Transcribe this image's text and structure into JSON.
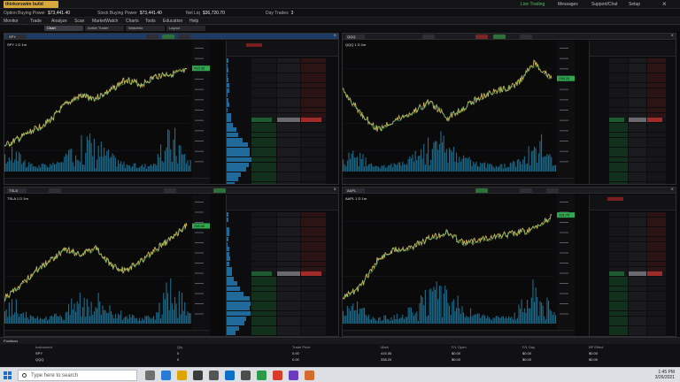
{
  "app": {
    "badge": "thinkorswim build",
    "top_links": [
      "Messages",
      "Support/Chat",
      "Setup"
    ],
    "status": "Live Trading"
  },
  "account_bar": [
    {
      "label": "Option Buying Power",
      "value": "$73,441.40"
    },
    {
      "label": "Stock Buying Power",
      "value": "$73,441.40"
    },
    {
      "label": "Net Liq",
      "value": "$36,720.70"
    },
    {
      "label": "Day Trades",
      "value": "3"
    }
  ],
  "menu": [
    "Monitor",
    "Trade",
    "Analyze",
    "Scan",
    "MarketWatch",
    "Charts",
    "Tools",
    "Education",
    "Help"
  ],
  "tabs": [
    "Chart",
    "Active Trader",
    "Watchlist",
    "Layout"
  ],
  "panels": [
    {
      "id": "tl",
      "symbol": "SPY",
      "title": "SPY 1 D 1m",
      "price_tag": "415.35",
      "active": true
    },
    {
      "id": "tr",
      "symbol": "QQQ",
      "title": "QQQ 1 D 1m",
      "price_tag": "338.20",
      "active": false
    },
    {
      "id": "bl",
      "symbol": "TSLA",
      "title": "TSLA 1 D 1m",
      "price_tag": "706.90",
      "active": false
    },
    {
      "id": "br",
      "symbol": "AAPL",
      "title": "AAPL 1 D 1m",
      "price_tag": "131.75",
      "active": false
    }
  ],
  "positions": {
    "title": "Positions",
    "columns": [
      "Instrument",
      "Qty",
      "Trade Price",
      "Mark",
      "P/L Open",
      "P/L Day",
      "BP Effect"
    ],
    "rows": [
      [
        "SPY",
        "0",
        "0.00",
        "415.35",
        "$0.00",
        "$0.00",
        "$0.00"
      ],
      [
        "QQQ",
        "0",
        "0.00",
        "338.20",
        "$0.00",
        "$0.00",
        "$0.00"
      ]
    ]
  },
  "taskbar": {
    "search_placeholder": "Type here to search",
    "time": "1:45 PM",
    "date": "3/26/2021"
  },
  "colors": {
    "accent": "#1e3b63",
    "price_up": "#4fbf6a",
    "price_line": "#c9b458",
    "volume": "#1c6d8f",
    "bid": "#1f5b32",
    "ask": "#7a2626"
  }
}
